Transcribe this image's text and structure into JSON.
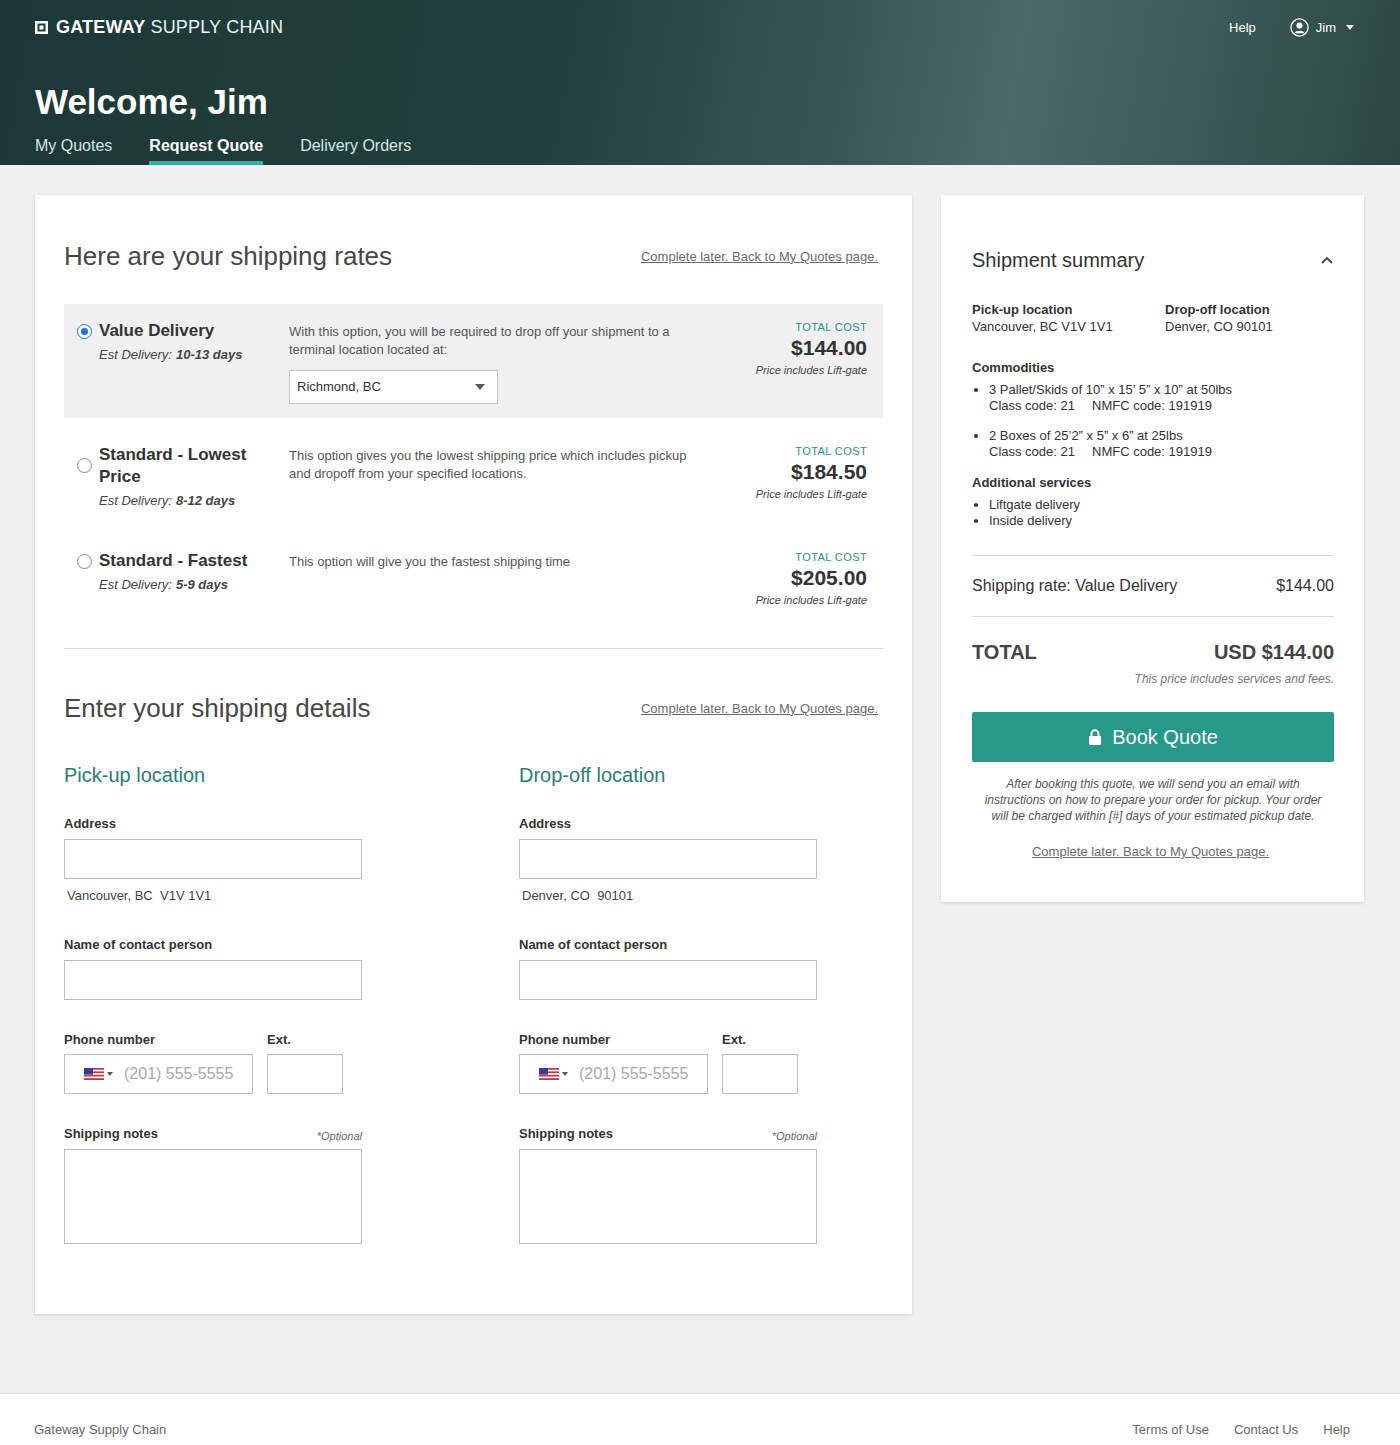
{
  "header": {
    "logo_bold": "GATEWAY",
    "logo_light": "SUPPLY CHAIN",
    "help": "Help",
    "user": "Jim",
    "welcome": "Welcome, Jim"
  },
  "tabs": [
    {
      "label": "My Quotes",
      "selected": false
    },
    {
      "label": "Request Quote",
      "selected": true
    },
    {
      "label": "Delivery Orders",
      "selected": false
    }
  ],
  "rates": {
    "title": "Here are your shipping rates",
    "later_link": "Complete later. Back to My Quotes page.",
    "options": [
      {
        "kind": "terminal",
        "name": "Value Delivery",
        "est_label": "Est Delivery:",
        "est_value": "10-13 days",
        "description": "With this option, you will be required to drop off your shipment to a terminal location located at:",
        "terminal": "Richmond, BC",
        "total_label": "TOTAL COST",
        "price": "$144.00",
        "price_note": "Price includes Lift-gate",
        "selected": true
      },
      {
        "kind": "door",
        "name": "Standard - Lowest Price",
        "est_label": "Est Delivery:",
        "est_value": "8-12 days",
        "description": "This option gives you the lowest shipping price which includes pickup and dropoff from your specified locations.",
        "total_label": "TOTAL COST",
        "price": "$184.50",
        "price_note": "Price includes Lift-gate",
        "selected": false
      },
      {
        "kind": "door",
        "name": "Standard - Fastest",
        "est_label": "Est Delivery:",
        "est_value": "5-9 days",
        "description": "This option will give you the fastest shipping time",
        "total_label": "TOTAL COST",
        "price": "$205.00",
        "price_note": "Price includes Lift-gate",
        "selected": false
      }
    ]
  },
  "details": {
    "title": "Enter your shipping details",
    "later_link": "Complete later. Back to My Quotes page.",
    "locations": [
      {
        "heading": "Pick-up location",
        "address_label": "Address",
        "address_hint": "Vancouver, BC  V1V 1V1",
        "contact_label": "Name of contact person",
        "phone_label": "Phone number",
        "phone_placeholder": "(201) 555-5555",
        "ext_label": "Ext.",
        "notes_label": "Shipping notes",
        "notes_optional": "*Optional"
      },
      {
        "heading": "Drop-off location",
        "address_label": "Address",
        "address_hint": "Denver, CO  90101",
        "contact_label": "Name of contact person",
        "phone_label": "Phone number",
        "phone_placeholder": "(201) 555-5555",
        "ext_label": "Ext.",
        "notes_label": "Shipping notes",
        "notes_optional": "*Optional"
      }
    ]
  },
  "summary": {
    "title": "Shipment summary",
    "expanded": true,
    "pickup_label": "Pick-up location",
    "pickup_value": "Vancouver, BC V1V 1V1",
    "dropoff_label": "Drop-off location",
    "dropoff_value": "Denver, CO 90101",
    "commodities_label": "Commodities",
    "commodities": [
      {
        "line": "3 Pallet/Skids of 10” x 15’ 5” x 10” at 50lbs",
        "class_code": "Class code: 21",
        "nmfc": "NMFC code: 191919"
      },
      {
        "line": "2 Boxes of 25’2” x 5” x 6” at 25lbs",
        "class_code": "Class code: 21",
        "nmfc": "NMFC code: 191919"
      }
    ],
    "services_label": "Additional services",
    "services": [
      "Liftgate delivery",
      "Inside delivery"
    ],
    "rate_label": "Shipping rate: Value Delivery",
    "rate_value": "$144.00",
    "total_label": "TOTAL",
    "total_value": "USD $144.00",
    "total_note": "This price includes services and fees.",
    "book_button": "Book Quote",
    "notice": "After booking this quote, we will send you an email with instructions on how to prepare your order for pickup. Your order will be charged within [#] days of your estimated pickup date.",
    "later_link": "Complete later. Back to My Quotes page."
  },
  "footer": {
    "brand": "Gateway Supply Chain",
    "links": [
      "Terms of Use",
      "Contact Us",
      "Help"
    ]
  }
}
